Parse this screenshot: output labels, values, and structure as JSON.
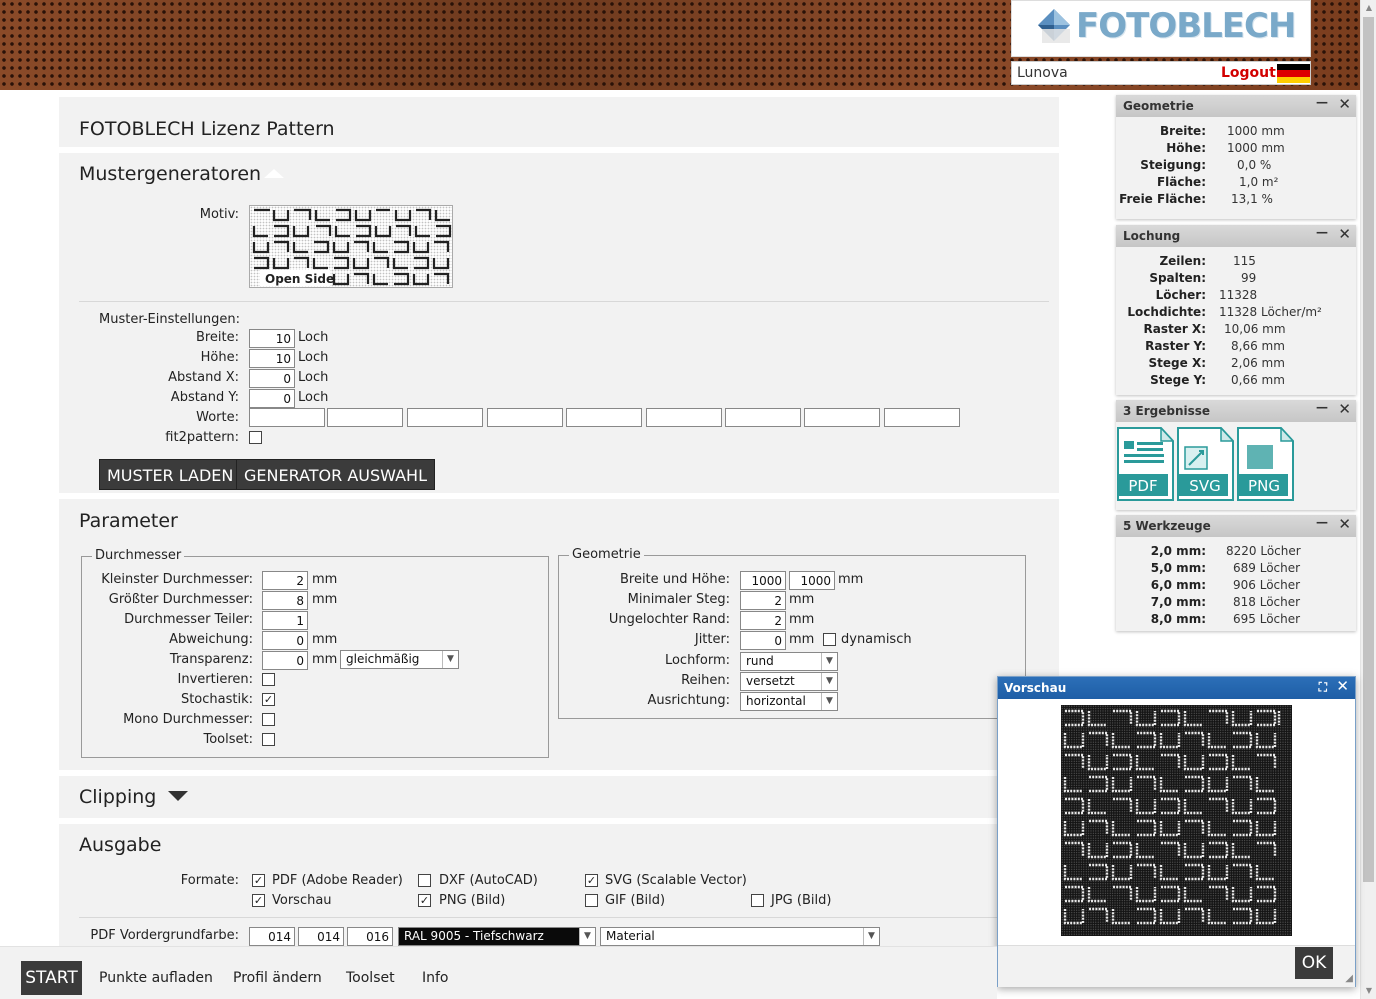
{
  "header": {
    "logo_text": "FOTOBLECH",
    "user_name": "Lunova",
    "logout_label": "Logout",
    "flag_colors": [
      "#000000",
      "#dd0000",
      "#ffce00"
    ]
  },
  "page_title": "FOTOBLECH Lizenz Pattern",
  "muster": {
    "title": "Mustergeneratoren",
    "motiv_label": "Motiv:",
    "motiv_caption": "Open Side",
    "settings_label": "Muster-Einstellungen:",
    "fields": [
      {
        "label": "Breite:",
        "value": "10",
        "unit": "Loch"
      },
      {
        "label": "Höhe:",
        "value": "10",
        "unit": "Loch"
      },
      {
        "label": "Abstand X:",
        "value": "0",
        "unit": "Loch"
      },
      {
        "label": "Abstand Y:",
        "value": "0",
        "unit": "Loch"
      }
    ],
    "worte_label": "Worte:",
    "worte_values": [
      "",
      "",
      "",
      "",
      "",
      "",
      "",
      "",
      ""
    ],
    "fit2pattern_label": "fit2pattern:",
    "fit2pattern_checked": false,
    "load_button": "MUSTER LADEN",
    "generator_button": "GENERATOR AUSWAHL"
  },
  "parameter": {
    "title": "Parameter",
    "durchmesser": {
      "legend": "Durchmesser",
      "kleinster_label": "Kleinster Durchmesser:",
      "kleinster_value": "2",
      "kleinster_unit": "mm",
      "groesster_label": "Größter Durchmesser:",
      "groesster_value": "8",
      "groesster_unit": "mm",
      "teiler_label": "Durchmesser Teiler:",
      "teiler_value": "1",
      "abweichung_label": "Abweichung:",
      "abweichung_value": "0",
      "abweichung_unit": "mm",
      "transparenz_label": "Transparenz:",
      "transparenz_value": "0",
      "transparenz_unit": "mm",
      "transparenz_mode": "gleichmäßig",
      "invertieren_label": "Invertieren:",
      "invertieren_checked": false,
      "stochastik_label": "Stochastik:",
      "stochastik_checked": true,
      "mono_label": "Mono Durchmesser:",
      "mono_checked": false,
      "toolset_label": "Toolset:",
      "toolset_checked": false
    },
    "geometrie": {
      "legend": "Geometrie",
      "breite_hoehe_label": "Breite und Höhe:",
      "breite_value": "1000",
      "hoehe_value": "1000",
      "breite_hoehe_unit": "mm",
      "steg_label": "Minimaler Steg:",
      "steg_value": "2",
      "steg_unit": "mm",
      "rand_label": "Ungelochter Rand:",
      "rand_value": "2",
      "rand_unit": "mm",
      "jitter_label": "Jitter:",
      "jitter_value": "0",
      "jitter_unit": "mm",
      "dynamisch_label": "dynamisch",
      "dynamisch_checked": false,
      "lochform_label": "Lochform:",
      "lochform_value": "rund",
      "reihen_label": "Reihen:",
      "reihen_value": "versetzt",
      "ausrichtung_label": "Ausrichtung:",
      "ausrichtung_value": "horizontal"
    }
  },
  "clipping": {
    "title": "Clipping"
  },
  "ausgabe": {
    "title": "Ausgabe",
    "formate_label": "Formate:",
    "formats": [
      {
        "label": "PDF (Adobe Reader)",
        "checked": true
      },
      {
        "label": "DXF (AutoCAD)",
        "checked": false
      },
      {
        "label": "SVG (Scalable Vector)",
        "checked": true
      },
      {
        "label": "Vorschau",
        "checked": true
      },
      {
        "label": "PNG (Bild)",
        "checked": true
      },
      {
        "label": "GIF (Bild)",
        "checked": false
      },
      {
        "label": "JPG (Bild)",
        "checked": false
      }
    ],
    "pdf_color_label": "PDF Vordergrundfarbe:",
    "pdf_color_values": [
      "014",
      "014",
      "016"
    ],
    "ral_value": "RAL 9005 - Tiefschwarz",
    "material_value": "Material"
  },
  "widgets": {
    "geometrie": {
      "title": "Geometrie",
      "rows": [
        {
          "key": "Breite:",
          "value": "1000 mm"
        },
        {
          "key": "Höhe:",
          "value": "1000 mm"
        },
        {
          "key": "Steigung:",
          "value": "0,0 %"
        },
        {
          "key": "Fläche:",
          "value": "1,0 m²"
        },
        {
          "key": "Freie Fläche:",
          "value": "13,1 %"
        }
      ]
    },
    "lochung": {
      "title": "Lochung",
      "rows": [
        {
          "key": "Zeilen:",
          "value": "115"
        },
        {
          "key": "Spalten:",
          "value": "99"
        },
        {
          "key": "Löcher:",
          "value": "11328"
        },
        {
          "key": "Lochdichte:",
          "value": "11328 Löcher/m²"
        },
        {
          "key": "Raster X:",
          "value": "10,06 mm"
        },
        {
          "key": "Raster Y:",
          "value": "8,66 mm"
        },
        {
          "key": "Stege X:",
          "value": "2,06 mm"
        },
        {
          "key": "Stege Y:",
          "value": "0,66 mm"
        }
      ]
    },
    "ergebnisse": {
      "title": "3 Ergebnisse",
      "files": [
        "PDF",
        "SVG",
        "PNG"
      ]
    },
    "werkzeuge": {
      "title": "5 Werkzeuge",
      "rows": [
        {
          "key": "2,0 mm:",
          "value": "8220 Löcher"
        },
        {
          "key": "5,0 mm:",
          "value": "689 Löcher"
        },
        {
          "key": "6,0 mm:",
          "value": "906 Löcher"
        },
        {
          "key": "7,0 mm:",
          "value": "818 Löcher"
        },
        {
          "key": "8,0 mm:",
          "value": "695 Löcher"
        }
      ]
    }
  },
  "vorschau": {
    "title": "Vorschau",
    "ok_label": "OK"
  },
  "nav": {
    "start": "START",
    "items": [
      "Punkte aufladen",
      "Profil ändern",
      "Toolset",
      "Info"
    ]
  },
  "colors": {
    "accent_teal": "#2a9a9a",
    "dark_button": "#3b3b3b",
    "dialog_header": "#2266b0",
    "logout_red": "#d20000"
  }
}
